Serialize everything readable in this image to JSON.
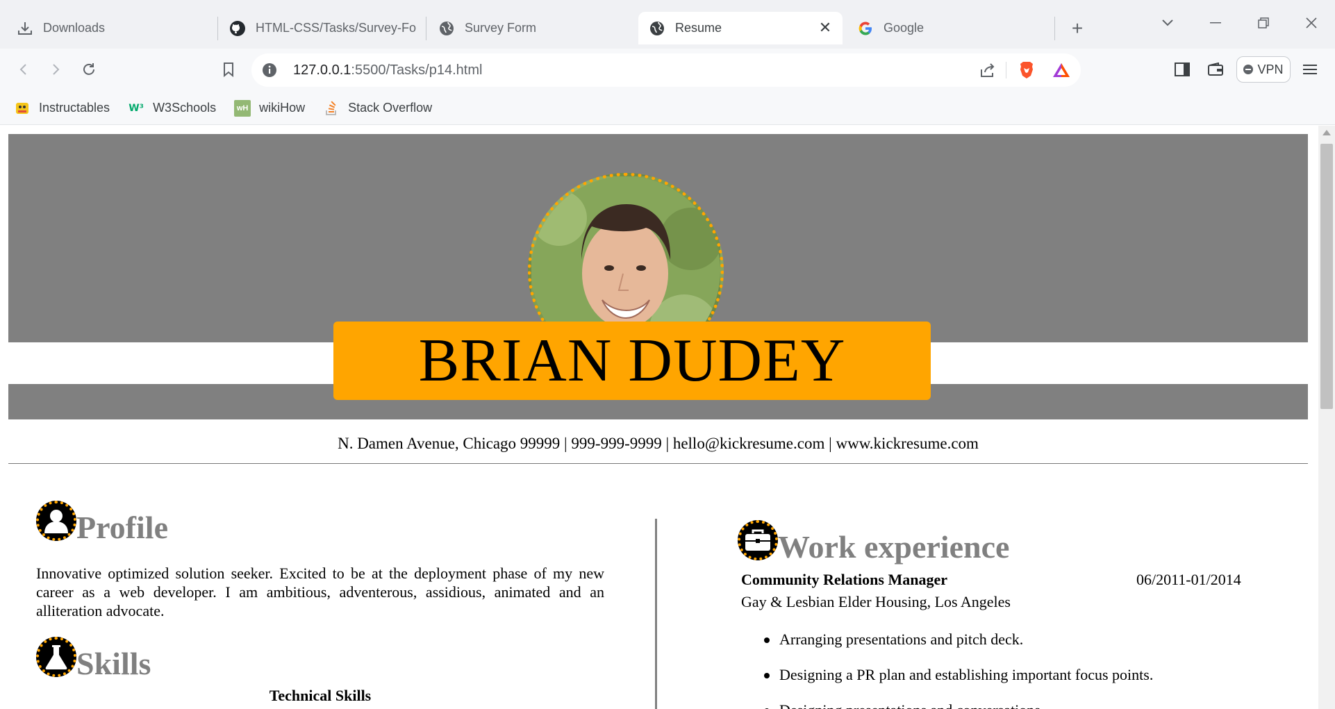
{
  "browser": {
    "tabs": [
      {
        "label": "Downloads",
        "icon": "download-icon"
      },
      {
        "label": "HTML-CSS/Tasks/Survey-Form",
        "icon": "github-icon"
      },
      {
        "label": "Survey Form",
        "icon": "globe-icon"
      },
      {
        "label": "Resume",
        "icon": "globe-icon",
        "active": true
      },
      {
        "label": "Google",
        "icon": "google-icon"
      }
    ],
    "url_host": "127.0.0.1",
    "url_path": ":5500/Tasks/p14.html",
    "vpn_label": "VPN",
    "bookmarks": [
      {
        "label": "Instructables",
        "icon": "instructables-icon"
      },
      {
        "label": "W3Schools",
        "icon": "w3schools-icon"
      },
      {
        "label": "wikiHow",
        "icon": "wikihow-icon"
      },
      {
        "label": "Stack Overflow",
        "icon": "stackoverflow-icon"
      }
    ]
  },
  "colors": {
    "band": "#808080",
    "accent": "#ffa500",
    "section_title": "#808080"
  },
  "resume": {
    "name": "BRIAN DUDEY",
    "contact": "N. Damen Avenue, Chicago 99999 | 999-999-9999 | hello@kickresume.com | www.kickresume.com",
    "profile": {
      "title": "Profile",
      "text": "Innovative optimized solution seeker. Excited to be at the deployment phase of my new career as a web developer. I am ambitious, adventerous, assidious, animated and an alliteration advocate."
    },
    "skills": {
      "title": "Skills",
      "subheading": "Technical Skills"
    },
    "work": {
      "title": "Work experience",
      "job_title": "Community Relations Manager",
      "dates": "06/2011-01/2014",
      "org": "Gay & Lesbian Elder Housing, Los Angeles",
      "bullets": [
        "Arranging presentations and pitch deck.",
        "Designing a PR plan and establishing important focus points.",
        "Designing presentations and conversations."
      ]
    }
  }
}
